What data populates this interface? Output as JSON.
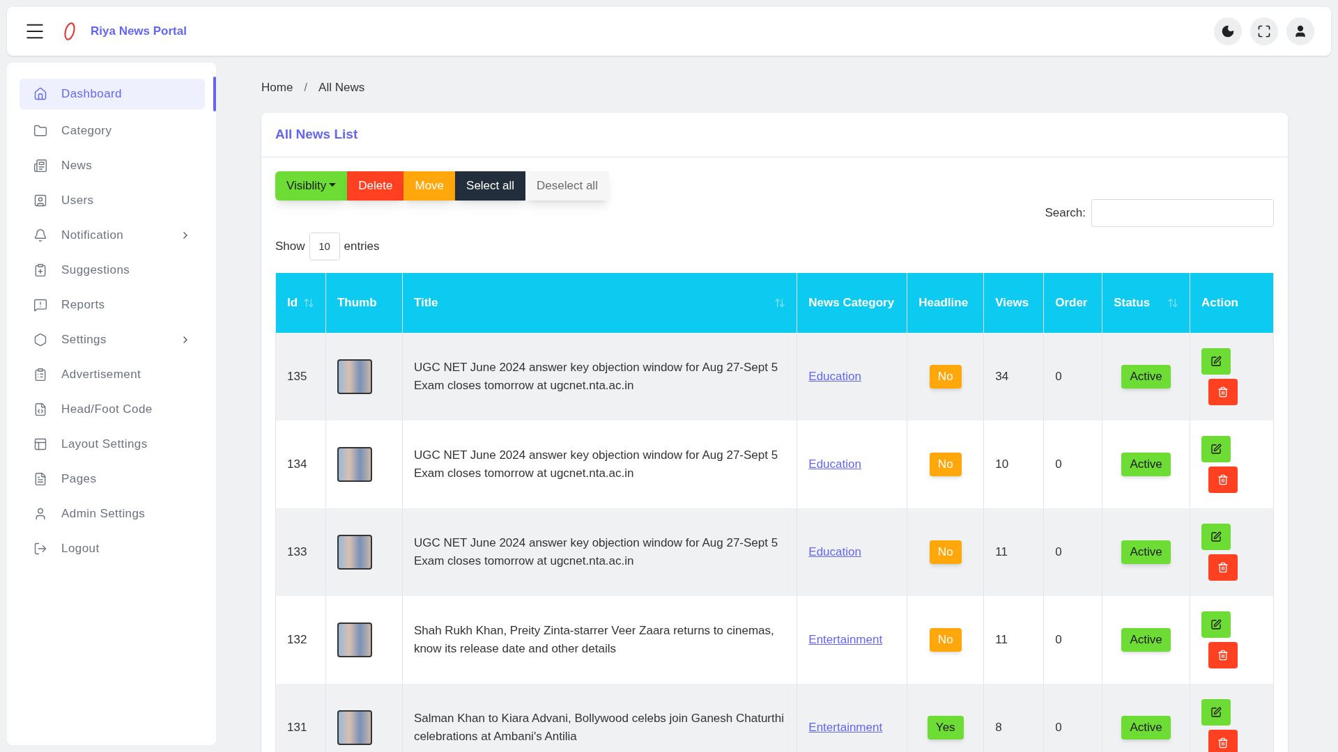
{
  "header": {
    "brand": "Riya News Portal"
  },
  "sidebar": {
    "items": [
      {
        "label": "Dashboard",
        "selected": true,
        "expandable": false
      },
      {
        "label": "Category",
        "selected": false,
        "expandable": false
      },
      {
        "label": "News",
        "selected": false,
        "expandable": false
      },
      {
        "label": "Users",
        "selected": false,
        "expandable": false
      },
      {
        "label": "Notification",
        "selected": false,
        "expandable": true
      },
      {
        "label": "Suggestions",
        "selected": false,
        "expandable": false
      },
      {
        "label": "Reports",
        "selected": false,
        "expandable": false
      },
      {
        "label": "Settings",
        "selected": false,
        "expandable": true
      },
      {
        "label": "Advertisement",
        "selected": false,
        "expandable": false
      },
      {
        "label": "Head/Foot Code",
        "selected": false,
        "expandable": false
      },
      {
        "label": "Layout Settings",
        "selected": false,
        "expandable": false
      },
      {
        "label": "Pages",
        "selected": false,
        "expandable": false
      },
      {
        "label": "Admin Settings",
        "selected": false,
        "expandable": false
      },
      {
        "label": "Logout",
        "selected": false,
        "expandable": false
      }
    ]
  },
  "breadcrumb": {
    "items": [
      "Home",
      "All News"
    ],
    "separator": "/"
  },
  "card": {
    "title": "All News List",
    "actions": [
      {
        "label": "Visiblity",
        "kind": "dropdown",
        "color": "#6ddc34"
      },
      {
        "label": "Delete",
        "kind": "button",
        "color": "#ff4122"
      },
      {
        "label": "Move",
        "kind": "button",
        "color": "#ffa70b"
      },
      {
        "label": "Select all",
        "kind": "button",
        "color": "#222e3c"
      },
      {
        "label": "Deselect all",
        "kind": "plain",
        "color": "#f6f6f6"
      }
    ],
    "search": {
      "label": "Search:"
    },
    "length": {
      "prefix": "Show",
      "value": "10",
      "suffix": "entries"
    },
    "table": {
      "columns": [
        {
          "label": "Id",
          "sortable": true
        },
        {
          "label": "Thumb",
          "sortable": false
        },
        {
          "label": "Title",
          "sortable": true
        },
        {
          "label": "News Category",
          "sortable": false
        },
        {
          "label": "Headline",
          "sortable": false
        },
        {
          "label": "Views",
          "sortable": false
        },
        {
          "label": "Order",
          "sortable": false
        },
        {
          "label": "Status",
          "sortable": true
        },
        {
          "label": "Action",
          "sortable": false
        }
      ],
      "rows": [
        {
          "id": "135",
          "title": "UGC NET June 2024 answer key objection window for Aug 27-Sept 5 Exam closes tomorrow at ugcnet.nta.ac.in",
          "category": "Education",
          "headline": {
            "text": "No",
            "color": "#ffa70b"
          },
          "views": "34",
          "order": "0",
          "status": "Active"
        },
        {
          "id": "134",
          "title": "UGC NET June 2024 answer key objection window for Aug 27-Sept 5 Exam closes tomorrow at ugcnet.nta.ac.in",
          "category": "Education",
          "headline": {
            "text": "No",
            "color": "#ffa70b"
          },
          "views": "10",
          "order": "0",
          "status": "Active"
        },
        {
          "id": "133",
          "title": "UGC NET June 2024 answer key objection window for Aug 27-Sept 5 Exam closes tomorrow at ugcnet.nta.ac.in",
          "category": "Education",
          "headline": {
            "text": "No",
            "color": "#ffa70b"
          },
          "views": "11",
          "order": "0",
          "status": "Active"
        },
        {
          "id": "132",
          "title": "Shah Rukh Khan, Preity Zinta-starrer Veer Zaara returns to cinemas, know its release date and other details",
          "category": "Entertainment",
          "headline": {
            "text": "No",
            "color": "#ffa70b"
          },
          "views": "11",
          "order": "0",
          "status": "Active"
        },
        {
          "id": "131",
          "title": "Salman Khan to Kiara Advani, Bollywood celebs join Ganesh Chaturthi celebrations at Ambani's Antilia",
          "category": "Entertainment",
          "headline": {
            "text": "Yes",
            "color": "#6ddc34"
          },
          "views": "8",
          "order": "0",
          "status": "Active"
        }
      ]
    }
  }
}
